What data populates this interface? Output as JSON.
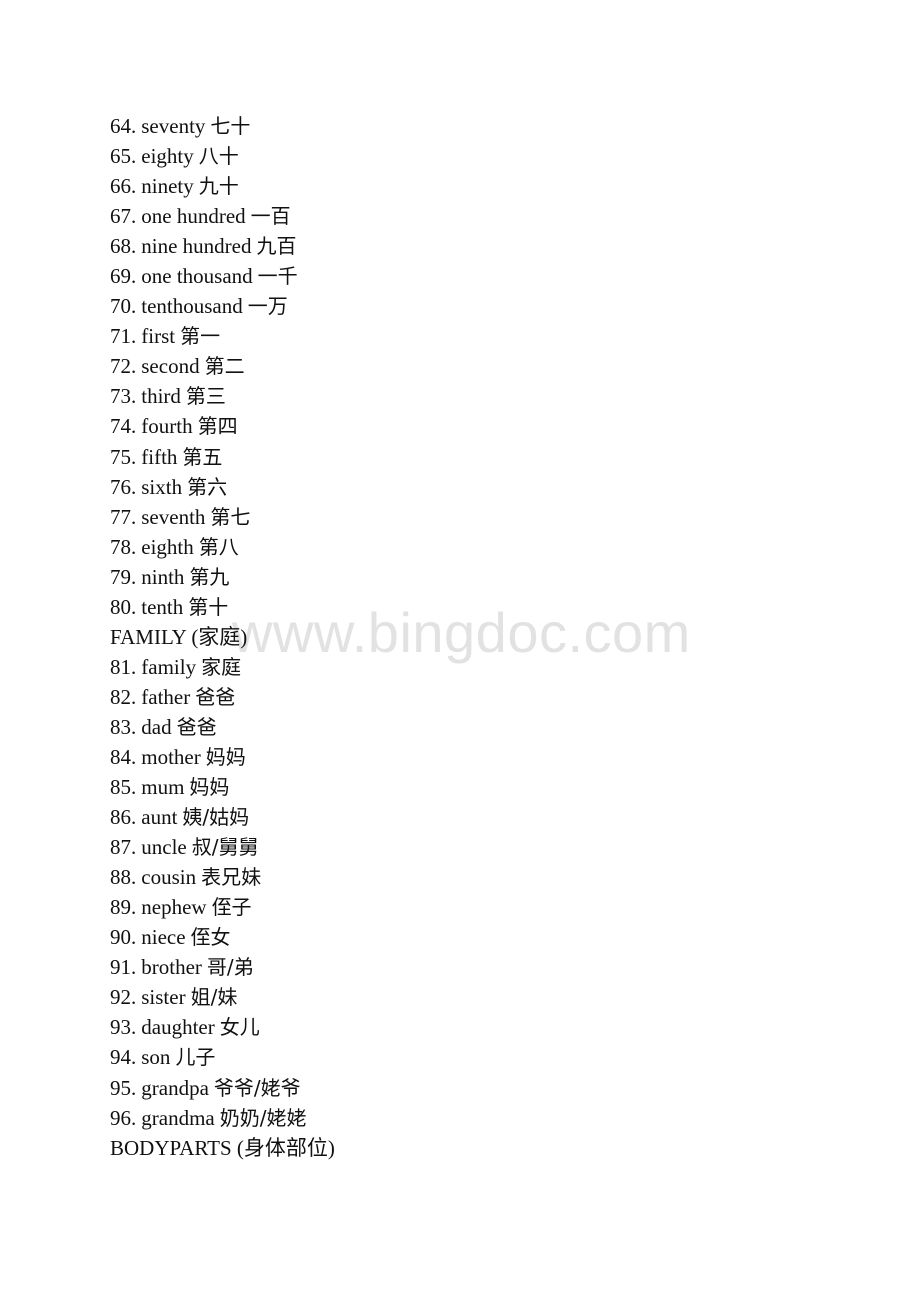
{
  "watermark": "www.bingdoc.com",
  "lines": [
    {
      "type": "item",
      "num": "64.",
      "en": "seventy",
      "cn": "七十"
    },
    {
      "type": "item",
      "num": "65.",
      "en": "eighty",
      "cn": "八十"
    },
    {
      "type": "item",
      "num": "66.",
      "en": "ninety",
      "cn": "九十"
    },
    {
      "type": "item",
      "num": "67.",
      "en": "one hundred",
      "cn": "一百"
    },
    {
      "type": "item",
      "num": "68.",
      "en": "nine hundred",
      "cn": "九百"
    },
    {
      "type": "item",
      "num": "69.",
      "en": "one thousand",
      "cn": "一千"
    },
    {
      "type": "item",
      "num": "70.",
      "en": "tenthousand",
      "cn": "一万"
    },
    {
      "type": "item",
      "num": "71.",
      "en": "first",
      "cn": "第一"
    },
    {
      "type": "item",
      "num": "72.",
      "en": "second",
      "cn": "第二"
    },
    {
      "type": "item",
      "num": "73.",
      "en": "third",
      "cn": "第三"
    },
    {
      "type": "item",
      "num": "74.",
      "en": "fourth",
      "cn": "第四"
    },
    {
      "type": "item",
      "num": "75.",
      "en": "fifth",
      "cn": "第五"
    },
    {
      "type": "item",
      "num": "76.",
      "en": "sixth",
      "cn": "第六"
    },
    {
      "type": "item",
      "num": "77.",
      "en": "seventh",
      "cn": "第七"
    },
    {
      "type": "item",
      "num": "78.",
      "en": "eighth",
      "cn": "第八"
    },
    {
      "type": "item",
      "num": "79.",
      "en": "ninth",
      "cn": "第九"
    },
    {
      "type": "item",
      "num": "80.",
      "en": "tenth",
      "cn": "第十"
    },
    {
      "type": "heading",
      "text": "FAMILY (家庭)"
    },
    {
      "type": "item",
      "num": "81.",
      "en": "family",
      "cn": "家庭"
    },
    {
      "type": "item",
      "num": "82.",
      "en": "father",
      "cn": "爸爸"
    },
    {
      "type": "item",
      "num": "83.",
      "en": "dad",
      "cn": "爸爸"
    },
    {
      "type": "item",
      "num": "84.",
      "en": "mother",
      "cn": "妈妈"
    },
    {
      "type": "item",
      "num": "85.",
      "en": "mum",
      "cn": "妈妈"
    },
    {
      "type": "item",
      "num": "86.",
      "en": "aunt",
      "cn": "姨/姑妈"
    },
    {
      "type": "item",
      "num": "87.",
      "en": "uncle",
      "cn": "叔/舅舅"
    },
    {
      "type": "item",
      "num": "88.",
      "en": "cousin",
      "cn": "表兄妹"
    },
    {
      "type": "item",
      "num": "89.",
      "en": "nephew",
      "cn": "侄子"
    },
    {
      "type": "item",
      "num": "90.",
      "en": "niece",
      "cn": "侄女"
    },
    {
      "type": "item",
      "num": "91.",
      "en": "brother",
      "cn": "哥/弟"
    },
    {
      "type": "item",
      "num": "92.",
      "en": "sister",
      "cn": "姐/妹"
    },
    {
      "type": "item",
      "num": "93.",
      "en": "daughter",
      "cn": "女儿"
    },
    {
      "type": "item",
      "num": "94.",
      "en": "son",
      "cn": "儿子"
    },
    {
      "type": "item",
      "num": "95.",
      "en": "grandpa",
      "cn": "爷爷/姥爷"
    },
    {
      "type": "item",
      "num": "96.",
      "en": "grandma",
      "cn": "奶奶/姥姥"
    },
    {
      "type": "heading",
      "text": "BODYPARTS (身体部位)"
    }
  ]
}
